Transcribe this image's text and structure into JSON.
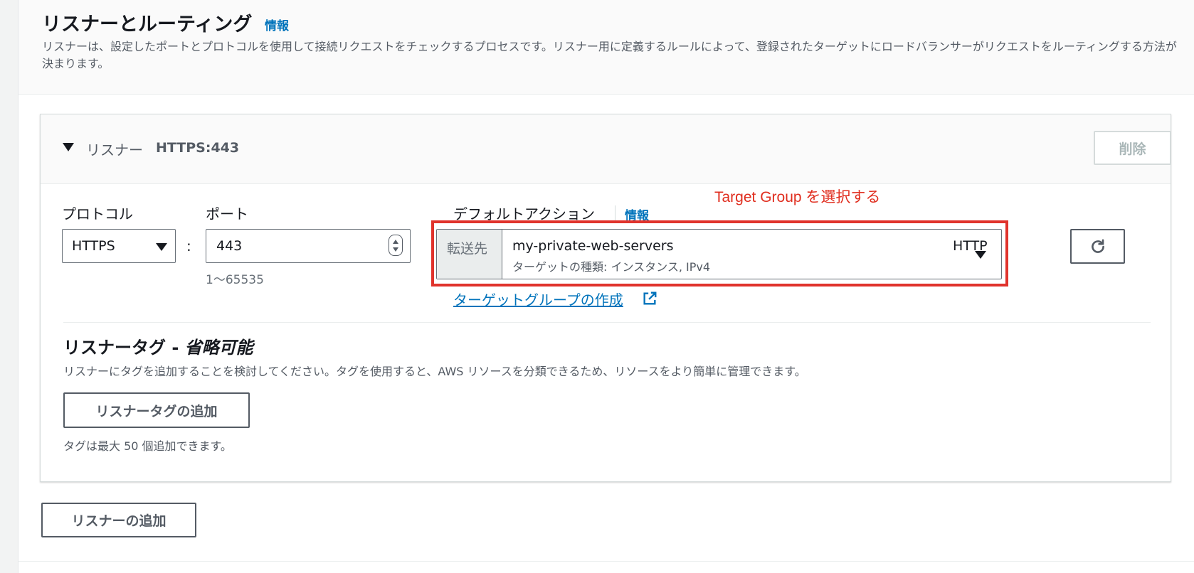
{
  "section": {
    "title": "リスナーとルーティング",
    "info_label": "情報",
    "description": "リスナーは、設定したポートとプロトコルを使用して接続リクエストをチェックするプロセスです。リスナー用に定義するルールによって、登録されたターゲットにロードバランサーがリクエストをルーティングする方法が決まります。"
  },
  "listener": {
    "label": "リスナー",
    "value": "HTTPS:443",
    "delete_label": "削除",
    "protocol_label": "プロトコル",
    "protocol_value": "HTTPS",
    "colon": ":",
    "port_label": "ポート",
    "port_value": "443",
    "port_hint": "1〜65535",
    "default_action_label": "デフォルトアクション",
    "default_action_info": "情報",
    "annotation": "Target Group を選択する",
    "forward_prefix": "転送先",
    "target_group_name": "my-private-web-servers",
    "target_group_sub": "ターゲットの種類: インスタンス, IPv4",
    "target_group_protocol": "HTTP",
    "create_tg_link": "ターゲットグループの作成",
    "tags_title": "リスナータグ - ",
    "tags_title_optional": "省略可能",
    "tags_desc": "リスナーにタグを追加することを検討してください。タグを使用すると、AWS リソースを分類できるため、リソースをより簡単に管理できます。",
    "add_tag_button": "リスナータグの追加",
    "tags_hint": "タグは最大 50 個追加できます。"
  },
  "add_listener_button": "リスナーの追加",
  "colors": {
    "link": "#0073bb",
    "annotation": "#e02e1f",
    "highlight_border": "#e0332c"
  },
  "icons": [
    "caret-down-icon",
    "stepper-icon",
    "chevron-down-icon",
    "refresh-icon",
    "external-link-icon"
  ]
}
